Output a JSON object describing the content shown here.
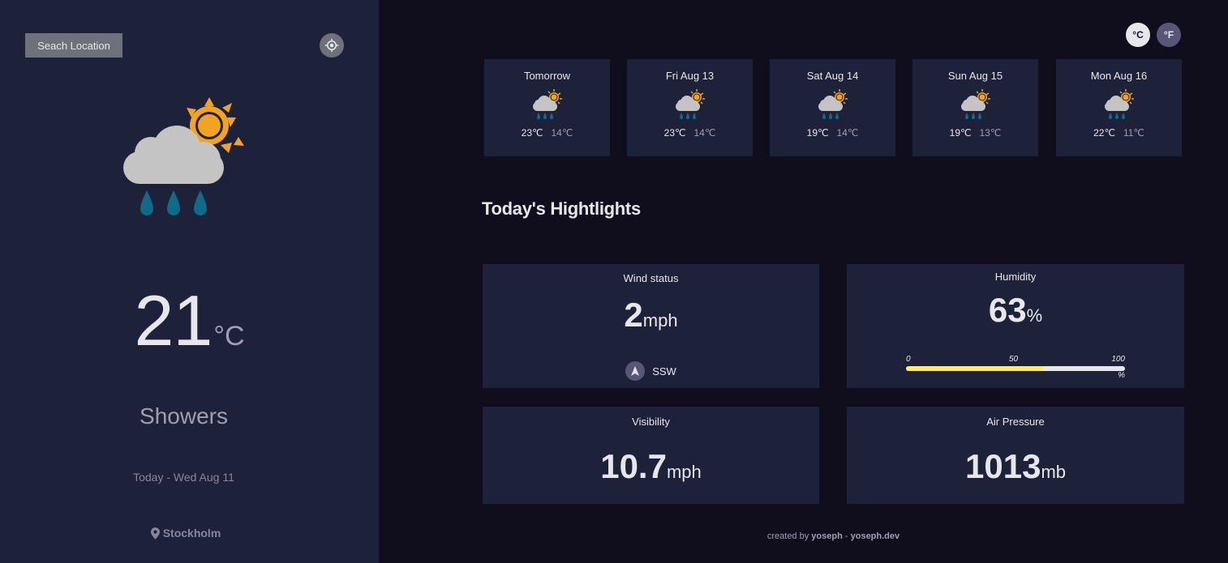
{
  "sidebar": {
    "search_label": "Seach Location",
    "locate_icon": "crosshair-icon",
    "weather_icon": "showers-icon",
    "temp_value": "21",
    "temp_unit": "°C",
    "condition": "Showers",
    "date": "Today - Wed Aug 11",
    "location": "Stockholm",
    "location_icon": "map-pin-icon"
  },
  "units": {
    "celsius": "°C",
    "fahrenheit": "°F",
    "active": "celsius"
  },
  "forecast": [
    {
      "day": "Tomorrow",
      "max": "23℃",
      "min": "14℃",
      "icon": "showers-icon"
    },
    {
      "day": "Fri Aug 13",
      "max": "23℃",
      "min": "14℃",
      "icon": "showers-icon"
    },
    {
      "day": "Sat Aug 14",
      "max": "19℃",
      "min": "14℃",
      "icon": "showers-icon"
    },
    {
      "day": "Sun Aug 15",
      "max": "19℃",
      "min": "13℃",
      "icon": "showers-icon"
    },
    {
      "day": "Mon Aug 16",
      "max": "22℃",
      "min": "11℃",
      "icon": "showers-icon"
    }
  ],
  "highlights": {
    "title": "Today's Hightlights",
    "wind": {
      "label": "Wind status",
      "value": "2",
      "unit": "mph",
      "direction": "SSW"
    },
    "humidity": {
      "label": "Humidity",
      "value": "63",
      "unit": "%",
      "scale_0": "0",
      "scale_50": "50",
      "scale_100": "100",
      "scale_unit": "%",
      "fraction": 0.63
    },
    "visibility": {
      "label": "Visibility",
      "value": "10.7",
      "unit": "mph"
    },
    "pressure": {
      "label": "Air Pressure",
      "value": "1013",
      "unit": "mb"
    }
  },
  "footer": {
    "prefix": "created by",
    "author": "yoseph",
    "sep": "-",
    "site": "yoseph.dev"
  },
  "colors": {
    "accent_bar": "#ffec65",
    "panel": "#1e213a",
    "background": "#100e1d"
  }
}
